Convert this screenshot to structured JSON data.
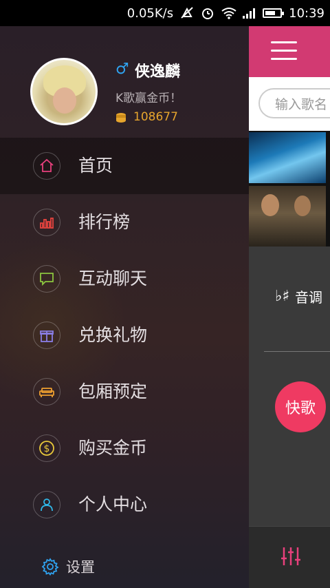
{
  "status_bar": {
    "speed": "0.05K/s",
    "time": "10:39"
  },
  "drawer": {
    "profile": {
      "gender_symbol": "♂",
      "username": "侠逸麟",
      "tagline": "K歌赢金币！",
      "coins": "108677"
    },
    "menu": [
      {
        "label": "首页",
        "icon": "home-icon",
        "color": "#e8407c",
        "active": true
      },
      {
        "label": "排行榜",
        "icon": "bar-chart-icon",
        "color": "#e8443f",
        "active": false
      },
      {
        "label": "互动聊天",
        "icon": "chat-icon",
        "color": "#8cc63f",
        "active": false
      },
      {
        "label": "兑换礼物",
        "icon": "gift-icon",
        "color": "#8a7ee6",
        "active": false
      },
      {
        "label": "包厢预定",
        "icon": "sofa-icon",
        "color": "#f0a030",
        "active": false
      },
      {
        "label": "购买金币",
        "icon": "dollar-coin-icon",
        "color": "#e8c83a",
        "active": false
      },
      {
        "label": "个人中心",
        "icon": "user-icon",
        "color": "#2fb8e8",
        "active": false
      }
    ],
    "settings_label": "设置"
  },
  "main": {
    "search_placeholder": "输入歌名",
    "tone_symbol": "♭♯",
    "tone_label": "音调",
    "quick_song_label": "快歌"
  },
  "colors": {
    "brand_pink": "#d23a72",
    "quick_button": "#ef3a62",
    "coin_gold": "#e6a52d",
    "gender_blue": "#2fa3f0"
  }
}
